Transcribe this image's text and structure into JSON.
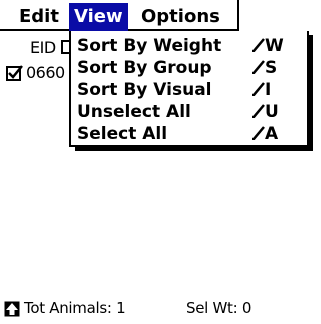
{
  "menubar": {
    "edit": "Edit",
    "view": "View",
    "options": "Options"
  },
  "form": {
    "eid_label": "EID",
    "row_text": "0660"
  },
  "dropdown": {
    "items": [
      {
        "label": "Sort By Weight",
        "shortcut": "W"
      },
      {
        "label": "Sort By Group",
        "shortcut": "S"
      },
      {
        "label": "Sort By Visual",
        "shortcut": "I"
      },
      {
        "label": "Unselect All",
        "shortcut": "U"
      },
      {
        "label": "Select All",
        "shortcut": "A"
      }
    ]
  },
  "footer": {
    "tot_animals": "Tot Animals: 1",
    "sel_wt": "Sel Wt: 0"
  },
  "colors": {
    "highlight": "#0a0ca6",
    "background": "#ffffff",
    "foreground": "#000000"
  }
}
